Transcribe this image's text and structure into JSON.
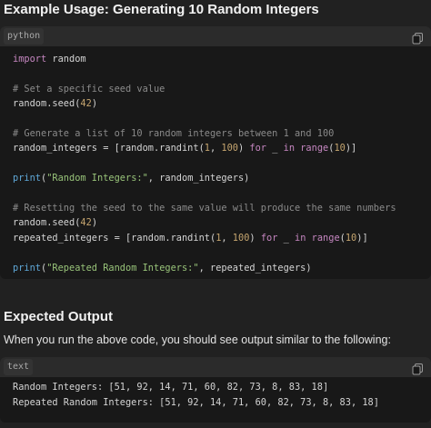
{
  "section1": {
    "title": "Example Usage: Generating 10 Random Integers",
    "code_lang": "python",
    "lines": [
      {
        "parts": [
          {
            "t": "import",
            "c": "kw"
          },
          {
            "t": " random",
            "c": ""
          }
        ]
      },
      {
        "parts": []
      },
      {
        "parts": [
          {
            "t": "# Set a specific seed value",
            "c": "cmt"
          }
        ]
      },
      {
        "parts": [
          {
            "t": "random.seed(",
            "c": ""
          },
          {
            "t": "42",
            "c": "num"
          },
          {
            "t": ")",
            "c": ""
          }
        ]
      },
      {
        "parts": []
      },
      {
        "parts": [
          {
            "t": "# Generate a list of 10 random integers between 1 and 100",
            "c": "cmt"
          }
        ]
      },
      {
        "parts": [
          {
            "t": "random_integers = [random.randint(",
            "c": ""
          },
          {
            "t": "1",
            "c": "num"
          },
          {
            "t": ", ",
            "c": ""
          },
          {
            "t": "100",
            "c": "num"
          },
          {
            "t": ") ",
            "c": ""
          },
          {
            "t": "for",
            "c": "kw"
          },
          {
            "t": " _ ",
            "c": ""
          },
          {
            "t": "in",
            "c": "kw"
          },
          {
            "t": " ",
            "c": ""
          },
          {
            "t": "range",
            "c": "blt"
          },
          {
            "t": "(",
            "c": ""
          },
          {
            "t": "10",
            "c": "num"
          },
          {
            "t": ")]",
            "c": ""
          }
        ]
      },
      {
        "parts": []
      },
      {
        "parts": [
          {
            "t": "print",
            "c": "fn"
          },
          {
            "t": "(",
            "c": ""
          },
          {
            "t": "\"Random Integers:\"",
            "c": "str"
          },
          {
            "t": ", random_integers)",
            "c": ""
          }
        ]
      },
      {
        "parts": []
      },
      {
        "parts": [
          {
            "t": "# Resetting the seed to the same value will produce the same numbers",
            "c": "cmt"
          }
        ]
      },
      {
        "parts": [
          {
            "t": "random.seed(",
            "c": ""
          },
          {
            "t": "42",
            "c": "num"
          },
          {
            "t": ")",
            "c": ""
          }
        ]
      },
      {
        "parts": [
          {
            "t": "repeated_integers = [random.randint(",
            "c": ""
          },
          {
            "t": "1",
            "c": "num"
          },
          {
            "t": ", ",
            "c": ""
          },
          {
            "t": "100",
            "c": "num"
          },
          {
            "t": ") ",
            "c": ""
          },
          {
            "t": "for",
            "c": "kw"
          },
          {
            "t": " _ ",
            "c": ""
          },
          {
            "t": "in",
            "c": "kw"
          },
          {
            "t": " ",
            "c": ""
          },
          {
            "t": "range",
            "c": "blt"
          },
          {
            "t": "(",
            "c": ""
          },
          {
            "t": "10",
            "c": "num"
          },
          {
            "t": ")]",
            "c": ""
          }
        ]
      },
      {
        "parts": []
      },
      {
        "parts": [
          {
            "t": "print",
            "c": "fn"
          },
          {
            "t": "(",
            "c": ""
          },
          {
            "t": "\"Repeated Random Integers:\"",
            "c": "str"
          },
          {
            "t": ", repeated_integers)",
            "c": ""
          }
        ]
      }
    ]
  },
  "section2": {
    "title": "Expected Output",
    "description": "When you run the above code, you should see output similar to the following:",
    "code_lang": "text",
    "lines": [
      {
        "parts": [
          {
            "t": "Random Integers: [51, 92, 14, 71, 60, 82, 73, 8, 83, 18]",
            "c": ""
          }
        ]
      },
      {
        "parts": [
          {
            "t": "Repeated Random Integers: [51, 92, 14, 71, 60, 82, 73, 8, 83, 18]",
            "c": ""
          }
        ]
      }
    ]
  },
  "icons": {
    "copy": "copy-icon"
  },
  "colors": {
    "background": "#212121",
    "code_background": "#181818",
    "keyword": "#c586c0",
    "number": "#c5a56f",
    "string": "#98c379",
    "comment": "#8a8a8a",
    "function": "#5fa8d8"
  }
}
